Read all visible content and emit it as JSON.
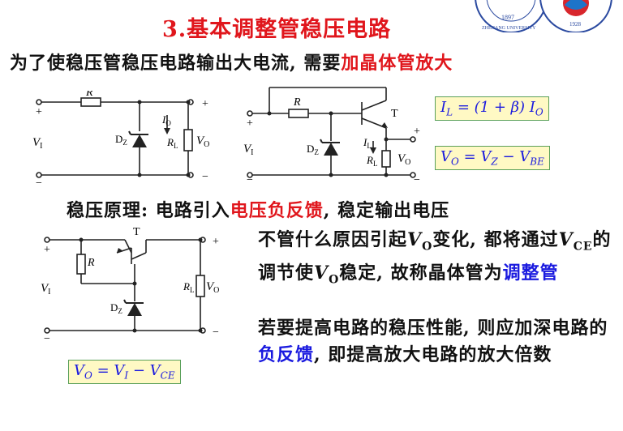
{
  "title": "3.基本调整管稳压电路",
  "intro": {
    "before": "为了使稳压管稳压电路输出大电流, 需要",
    "highlight": "加晶体管放大"
  },
  "principle": {
    "before": "稳压原理: 电路引入",
    "highlight": "电压负反馈",
    "after": ", 稳定输出电压"
  },
  "explain1": {
    "a": "不管什么原因引起",
    "v1": "V",
    "v1sub": "O",
    "b": "变化, 都将通过",
    "v2": "V",
    "v2sub": "CE",
    "c": "的调节使",
    "v3": "V",
    "v3sub": "O",
    "d": "稳定, 故称晶体管为",
    "highlight": "调整管"
  },
  "explain2": {
    "a": "若要提高电路的稳压性能, 则应加深电路的",
    "highlight": "负反馈",
    "b": ", 即提高放大电路的放大倍数"
  },
  "formulas": {
    "f1": "I_L = (1+β) I_O",
    "f2": "V_O = V_Z − V_BE",
    "f3": "V_O = V_I − V_CE"
  },
  "circuit_labels": {
    "R": "R",
    "Dz": "D",
    "Dz_sub": "Z",
    "T": "T",
    "VI": "V",
    "VI_sub": "I",
    "VO": "V",
    "VO_sub": "O",
    "RL": "R",
    "RL_sub": "L",
    "IO": "I",
    "IO_sub": "O",
    "IL": "I",
    "IL_sub": "L",
    "plus": "+",
    "minus": "−"
  },
  "logo": {
    "year1": "1897",
    "text1": "ZHEJIANG UNIVERSITY",
    "year2": "1928"
  },
  "colors": {
    "title": "#e0161c",
    "highlight_red": "#e0161c",
    "highlight_blue": "#1a1adf",
    "formula_bg": "#fff9c4"
  }
}
